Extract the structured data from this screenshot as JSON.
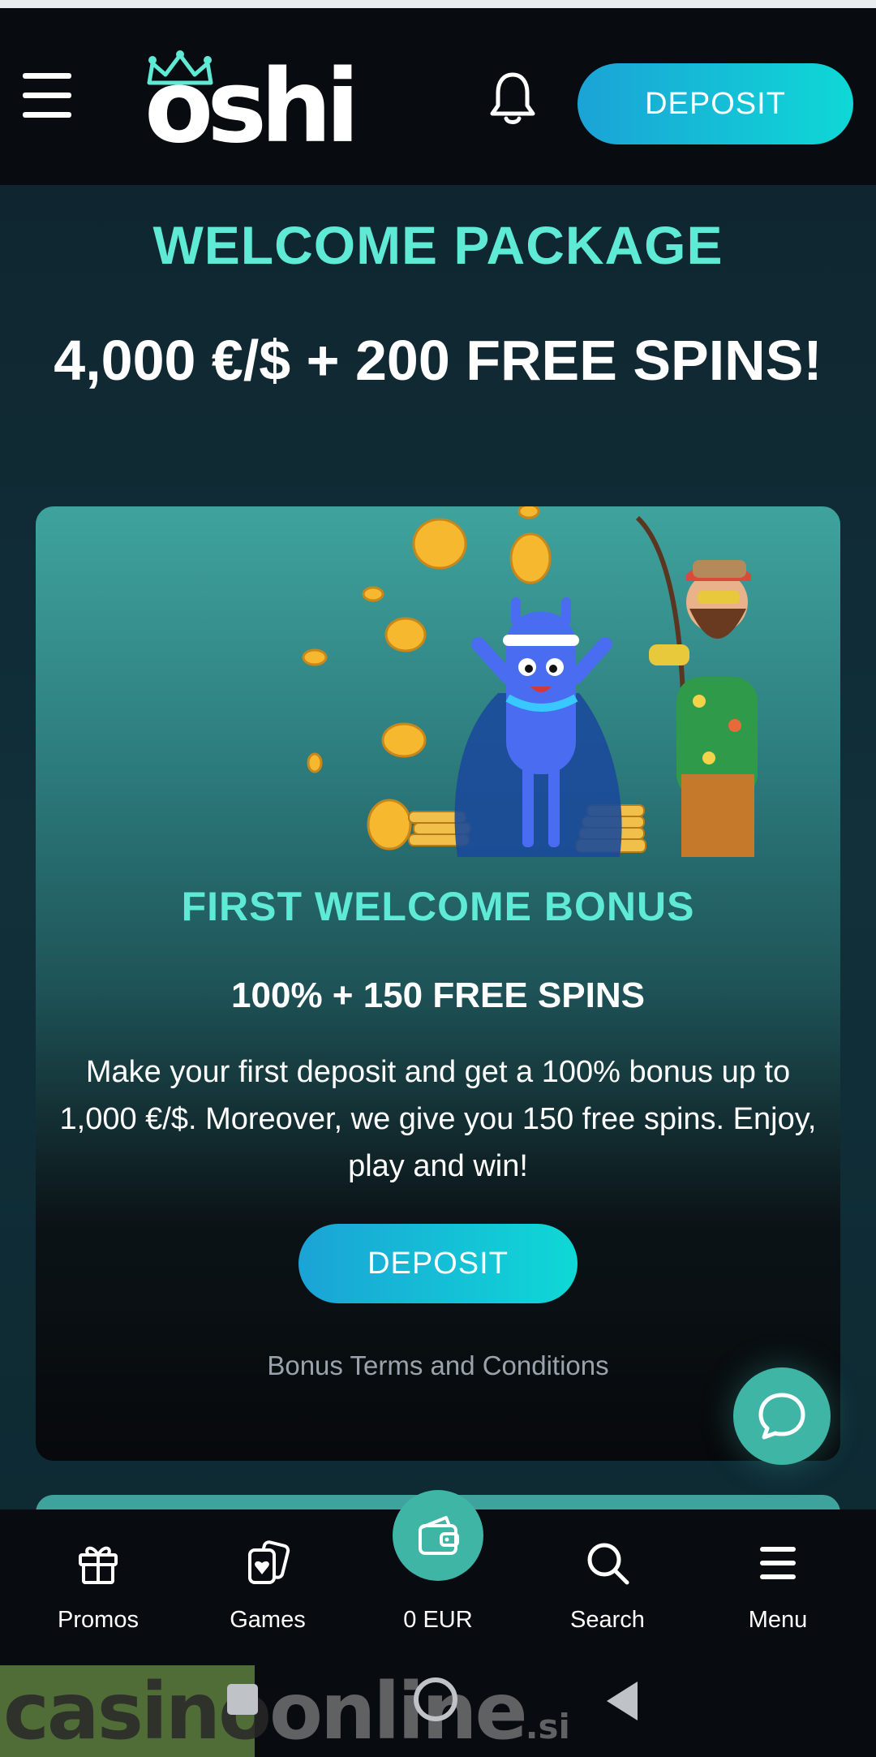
{
  "header": {
    "logo_text": "oshi",
    "deposit_label": "DEPOSIT"
  },
  "hero": {
    "title": "WELCOME PACKAGE",
    "subtitle": "4,000 €/$ + 200 FREE SPINS!"
  },
  "bonus_card": {
    "title": "FIRST WELCOME BONUS",
    "headline": "100% + 150 FREE SPINS",
    "description": "Make your first deposit and get a 100% bonus up to 1,000 €/$. Moreover, we give you 150 free spins. Enjoy, play and win!",
    "deposit_label": "DEPOSIT",
    "terms_label": "Bonus Terms and Conditions"
  },
  "bottom_nav": {
    "items": [
      {
        "label": "Promos",
        "icon": "gift-icon"
      },
      {
        "label": "Games",
        "icon": "cards-icon"
      },
      {
        "label": "0 EUR",
        "icon": "wallet-icon"
      },
      {
        "label": "Search",
        "icon": "search-icon"
      },
      {
        "label": "Menu",
        "icon": "menu-icon"
      }
    ]
  },
  "watermark": {
    "casino": "casino",
    "online": "online",
    "si": ".si"
  },
  "colors": {
    "accent": "#5eead4",
    "button_start": "#1ba3d6",
    "button_end": "#0fd8d6",
    "fab": "#3fb5a6",
    "header_bg": "#080b0f",
    "page_bg": "#0f2630"
  }
}
